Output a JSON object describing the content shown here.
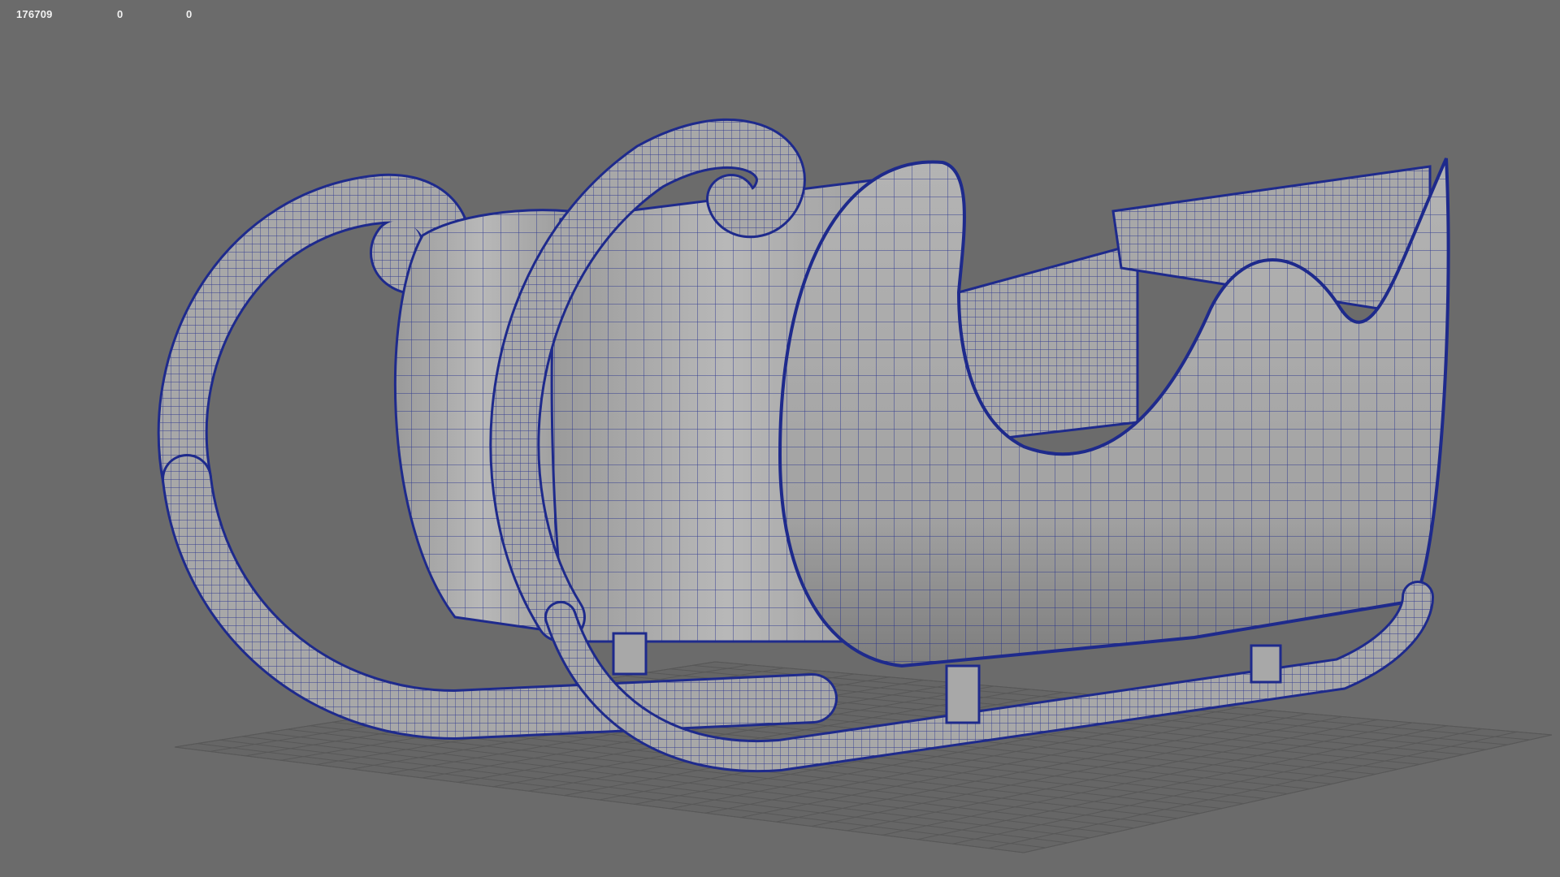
{
  "hud": {
    "values": [
      "176709",
      "0",
      "0"
    ]
  },
  "viewport": {
    "background": "#6b6b6b",
    "wire_color": "#1e2a8c",
    "grid_color": "#5a5a5a",
    "surface_color": "#a9a9a9",
    "object_icon": "sleigh-wireframe-model"
  }
}
